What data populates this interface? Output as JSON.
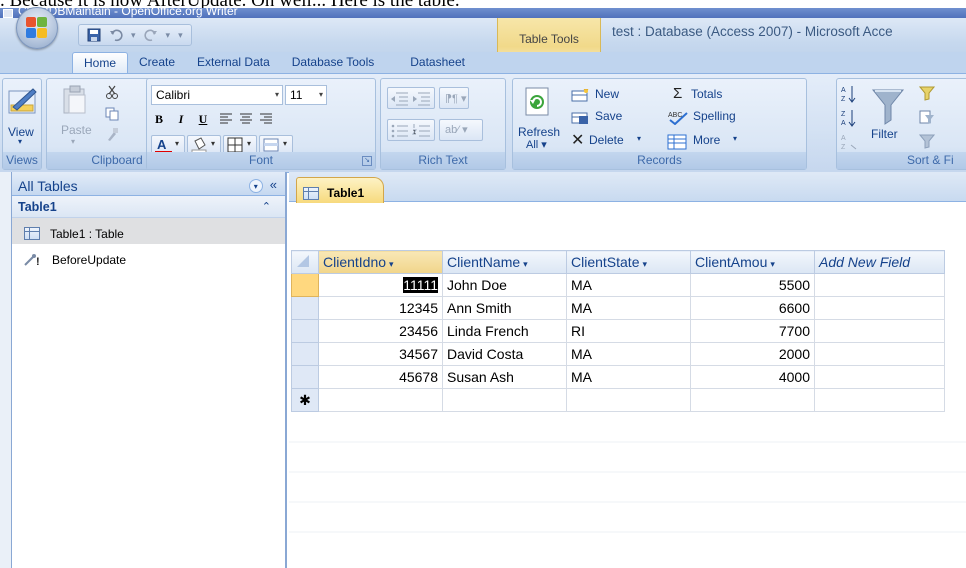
{
  "doc_overlay_text": ". Because it is now AfterUpdate. Oh well... Here is the table.",
  "background_window_title": "ClientDBMaintain - OpenOffice.org Writer",
  "app": {
    "title": "test : Database (Access 2007) - Microsoft Acce",
    "context_tab_label": "Table Tools"
  },
  "ribbon_tabs": [
    "Home",
    "Create",
    "External Data",
    "Database Tools",
    "Datasheet"
  ],
  "ribbon": {
    "views": {
      "view_label": "View",
      "group_label": "Views"
    },
    "clipboard": {
      "paste_label": "Paste",
      "group_label": "Clipboard"
    },
    "font": {
      "font_name": "Calibri",
      "font_size": "11",
      "group_label": "Font",
      "bold": "B",
      "italic": "I",
      "underline": "U",
      "font_color_letter": "A"
    },
    "rich_text": {
      "group_label": "Rich Text"
    },
    "records": {
      "refresh_label": "Refresh",
      "refresh_sub": "All",
      "new_label": "New",
      "save_label": "Save",
      "delete_label": "Delete",
      "totals_label": "Totals",
      "spelling_label": "Spelling",
      "more_label": "More",
      "group_label": "Records"
    },
    "sort_filter": {
      "filter_label": "Filter",
      "group_label": "Sort & Fi"
    }
  },
  "nav_pane": {
    "header": "All Tables",
    "group": "Table1",
    "items": [
      {
        "label": "Table1 : Table",
        "selected": true,
        "icon": "table-icon"
      },
      {
        "label": "BeforeUpdate",
        "selected": false,
        "icon": "macro-icon"
      }
    ]
  },
  "document": {
    "tab_label": "Table1",
    "columns": [
      "ClientIdno",
      "ClientName",
      "ClientState",
      "ClientAmou",
      "Add New Field"
    ],
    "rows": [
      {
        "id": "11111",
        "name": "John Doe",
        "state": "MA",
        "amount": "5500"
      },
      {
        "id": "12345",
        "name": "Ann Smith",
        "state": "MA",
        "amount": "6600"
      },
      {
        "id": "23456",
        "name": "Linda French",
        "state": "RI",
        "amount": "7700"
      },
      {
        "id": "34567",
        "name": "David Costa",
        "state": "MA",
        "amount": "2000"
      },
      {
        "id": "45678",
        "name": "Susan Ash",
        "state": "MA",
        "amount": "4000"
      }
    ],
    "new_record_marker": "✱"
  },
  "colors": {
    "ribbon_blue": "#c6d7ee",
    "context_tab": "#f1d98a",
    "selected_row": "#ffd87f"
  }
}
